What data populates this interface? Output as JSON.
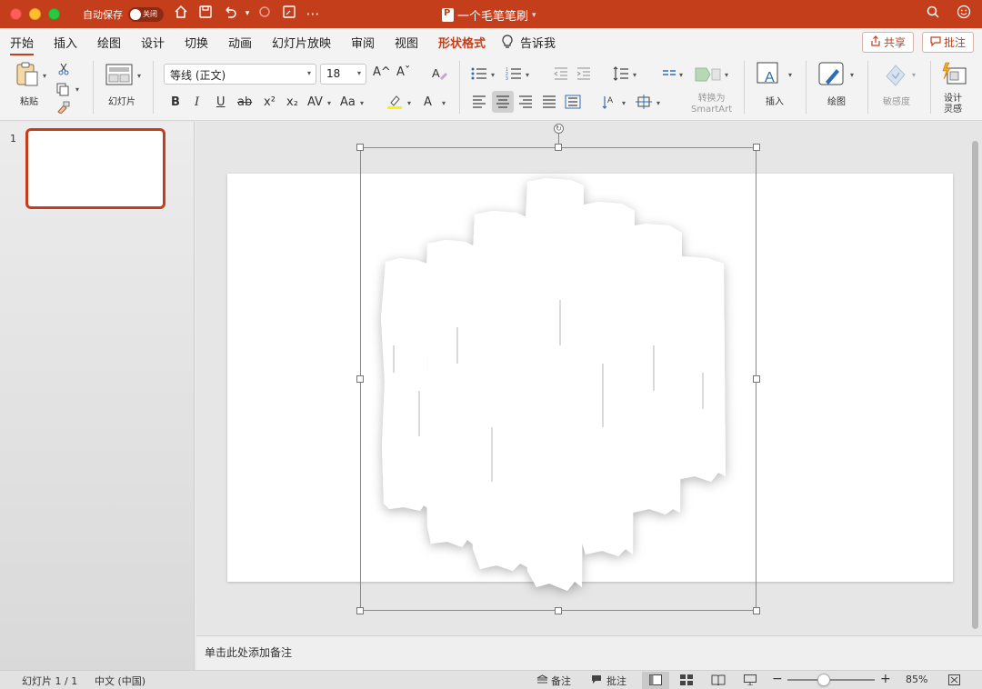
{
  "titlebar": {
    "autosave_label": "自动保存",
    "autosave_state": "关闭",
    "document_title": "一个毛笔笔刷",
    "colors": {
      "accent": "#c43e1c"
    }
  },
  "tabs": [
    {
      "label": "开始"
    },
    {
      "label": "插入"
    },
    {
      "label": "绘图"
    },
    {
      "label": "设计"
    },
    {
      "label": "切换"
    },
    {
      "label": "动画"
    },
    {
      "label": "幻灯片放映"
    },
    {
      "label": "审阅"
    },
    {
      "label": "视图"
    },
    {
      "label": "形状格式"
    },
    {
      "label": "告诉我"
    }
  ],
  "actions": {
    "share": "共享",
    "comments": "批注"
  },
  "ribbon": {
    "paste": "粘贴",
    "slides": "幻灯片",
    "font_name": "等线 (正文)",
    "font_size": "18",
    "bold": "B",
    "italic": "I",
    "underline": "U",
    "strike": "ab",
    "superscript": "x²",
    "subscript": "x₂",
    "spacing": "AV",
    "case": "Aa",
    "font_color": "A",
    "increase_font": "A^",
    "decrease_font": "Aˇ",
    "smartart": "转换为\nSmartArt",
    "insert": "插入",
    "draw": "绘图",
    "sensitivity": "敏感度",
    "designer": "设计\n灵感"
  },
  "slide_panel": {
    "slide_number": "1"
  },
  "notes": {
    "placeholder": "单击此处添加备注"
  },
  "status": {
    "slide_info": "幻灯片 1 / 1",
    "language": "中文 (中国)",
    "notes": "备注",
    "comments": "批注",
    "zoom": "85%",
    "zoom_level": 0.45
  }
}
